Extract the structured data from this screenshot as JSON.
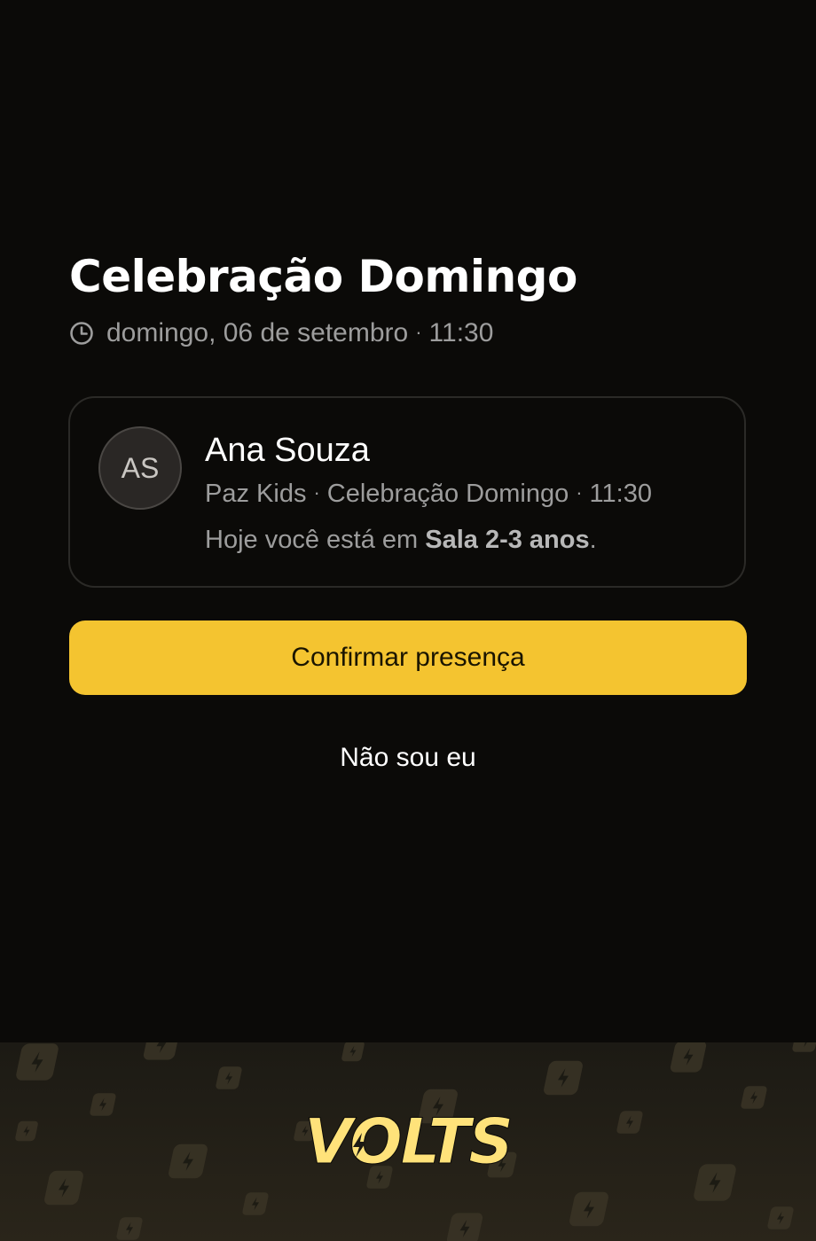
{
  "event": {
    "title": "Celebração Domingo",
    "date": "domingo, 06 de setembro",
    "time": "11:30",
    "separator": "·"
  },
  "icons": {
    "clock": "clock-icon"
  },
  "person": {
    "initials": "AS",
    "name": "Ana Souza",
    "ministry": "Paz Kids",
    "event_name": "Celebração Domingo",
    "time": "11:30",
    "room_prefix": "Hoje você está em",
    "room": "Sala 2-3 anos",
    "room_suffix": "."
  },
  "actions": {
    "confirm_label": "Confirmar presença",
    "not_me_label": "Não sou eu"
  },
  "brand": {
    "logo_text": "VOLTS",
    "accent_color": "#f4c430",
    "logo_color": "#ffe27a"
  }
}
